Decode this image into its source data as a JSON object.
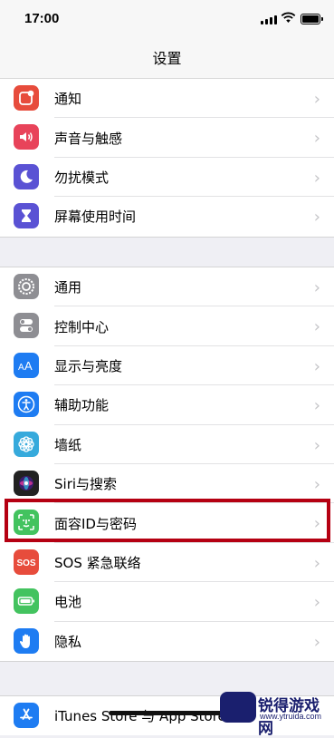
{
  "status_bar": {
    "time": "17:00"
  },
  "nav": {
    "title": "设置"
  },
  "groups": [
    {
      "items": [
        {
          "label": "通知",
          "icon": "notifications-icon",
          "color": "#e74c3c"
        },
        {
          "label": "声音与触感",
          "icon": "sound-icon",
          "color": "#e8435a"
        },
        {
          "label": "勿扰模式",
          "icon": "moon-icon",
          "color": "#5a52d4"
        },
        {
          "label": "屏幕使用时间",
          "icon": "hourglass-icon",
          "color": "#5a52d4"
        }
      ]
    },
    {
      "items": [
        {
          "label": "通用",
          "icon": "gear-icon",
          "color": "#8e8e93"
        },
        {
          "label": "控制中心",
          "icon": "toggles-icon",
          "color": "#8e8e93"
        },
        {
          "label": "显示与亮度",
          "icon": "text-size-icon",
          "color": "#1e7cf2"
        },
        {
          "label": "辅助功能",
          "icon": "accessibility-icon",
          "color": "#1e7cf2"
        },
        {
          "label": "墙纸",
          "icon": "flower-icon",
          "color": "#36aadc"
        },
        {
          "label": "Siri与搜索",
          "icon": "siri-icon",
          "color": "#222222"
        },
        {
          "label": "面容ID与密码",
          "icon": "face-id-icon",
          "color": "#43c35f"
        },
        {
          "label": "SOS 紧急联络",
          "icon": "sos-icon",
          "color": "#e74c3c"
        },
        {
          "label": "电池",
          "icon": "battery-icon",
          "color": "#43c35f"
        },
        {
          "label": "隐私",
          "icon": "hand-icon",
          "color": "#1e7cf2"
        }
      ]
    },
    {
      "items": [
        {
          "label": "iTunes Store 与 App Store",
          "icon": "app-store-icon",
          "color": "#1e7cf2"
        }
      ]
    }
  ],
  "chevron": "›",
  "watermark": {
    "title": "锐得游戏网",
    "url": "www.ytruida.com"
  }
}
